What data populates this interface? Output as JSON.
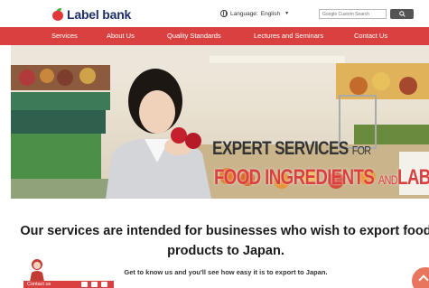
{
  "header": {
    "logo_text_accent": "",
    "logo_text": "Label bank",
    "language_label": "Language:",
    "language_value": "English",
    "search_placeholder": "Google Custom Search"
  },
  "nav": {
    "items": [
      "Services",
      "About Us",
      "Quality Standards",
      "Lectures and Seminars",
      "Contact Us"
    ]
  },
  "hero": {
    "line1_main": "EXPERT SERVICES",
    "line1_small": "FOR",
    "line2_part1": "FOOD INGREDIENTS",
    "line2_small": "AND",
    "line2_part2": "LABELS"
  },
  "content": {
    "intro": "Our services are intended for businesses who wish to export food products to Japan.",
    "sub": "Get to know us and you'll see how easy it is to export to Japan."
  },
  "contact": {
    "label": "Contact us"
  },
  "colors": {
    "brand_red": "#d94140",
    "brand_green": "#39a63d",
    "logo_navy": "#1f2d6b"
  }
}
